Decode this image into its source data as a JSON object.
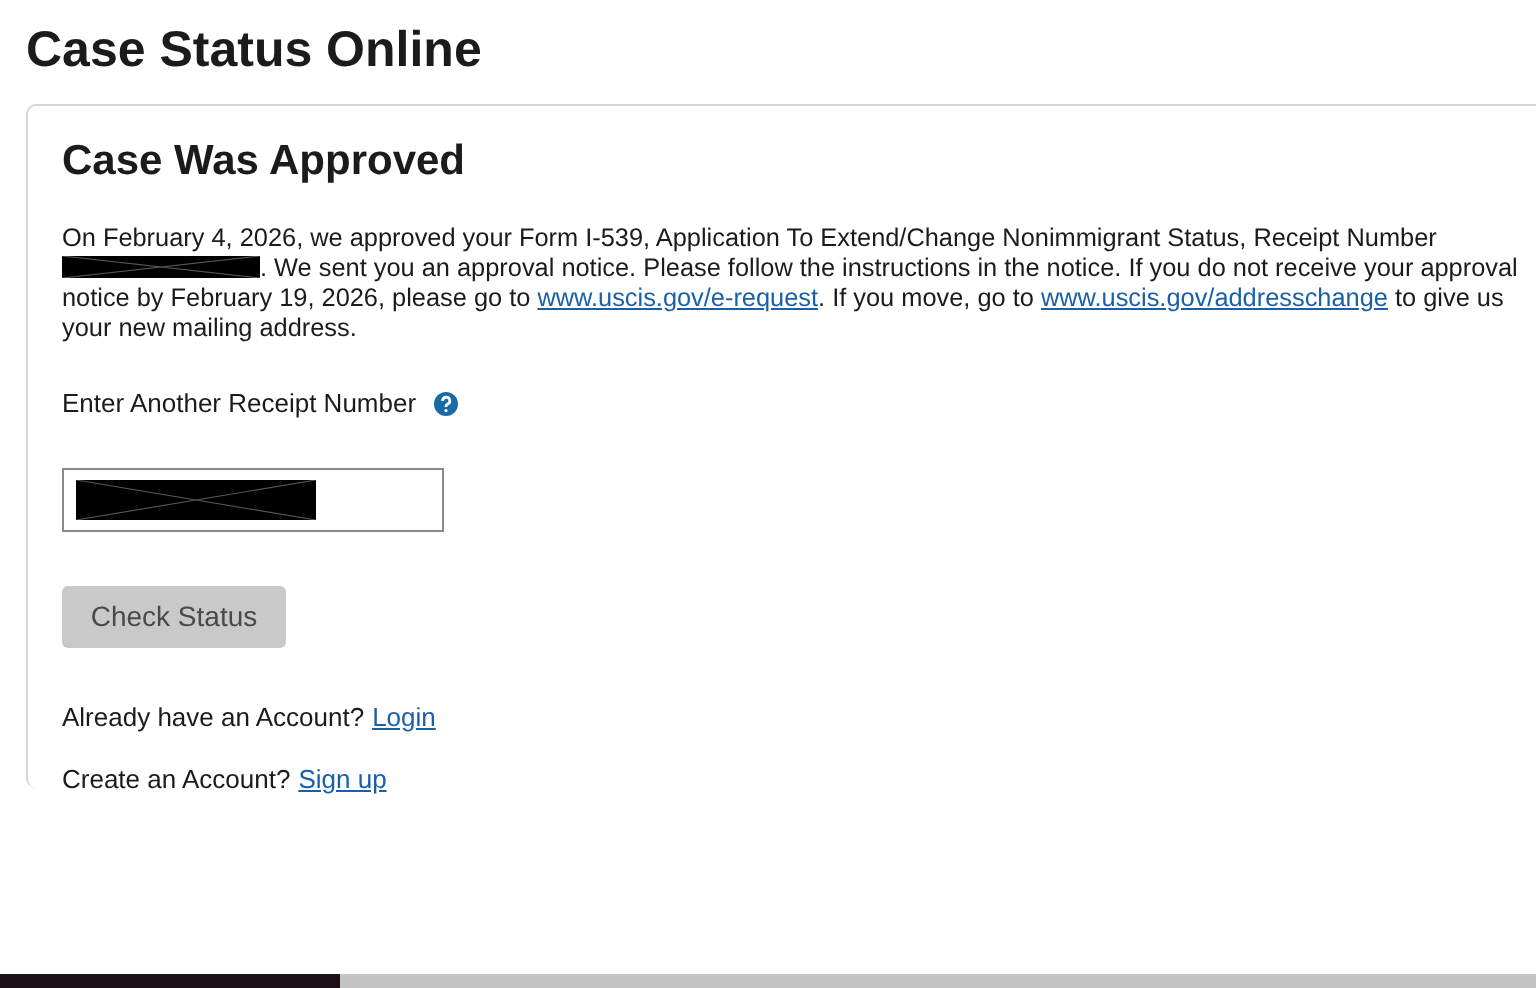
{
  "page_title": "Case Status Online",
  "status": {
    "heading": "Case Was Approved",
    "message": [
      {
        "kind": "text",
        "text": "On February 4, 2026, we approved your Form I-539, Application To Extend/Change Nonimmigrant Status, Receipt Number "
      },
      {
        "kind": "redacted"
      },
      {
        "kind": "text",
        "text": ". We sent you an approval notice. Please follow the instructions in the notice. If you do not receive your approval notice by February 19, 2026, please go to "
      },
      {
        "kind": "link",
        "text": "www.uscis.gov/e-request"
      },
      {
        "kind": "text",
        "text": ". If you move, go to "
      },
      {
        "kind": "link",
        "text": "www.uscis.gov/addresschange"
      },
      {
        "kind": "text",
        "text": " to give us your new mailing address."
      }
    ]
  },
  "receipt_field": {
    "label": "Enter Another Receipt Number",
    "value_redacted": true
  },
  "check_button": {
    "label": "Check Status",
    "disabled": true
  },
  "account_lines": [
    {
      "text": "Already have an Account?",
      "link": "Login"
    },
    {
      "text": "Create an Account?",
      "link": "Sign up"
    }
  ]
}
